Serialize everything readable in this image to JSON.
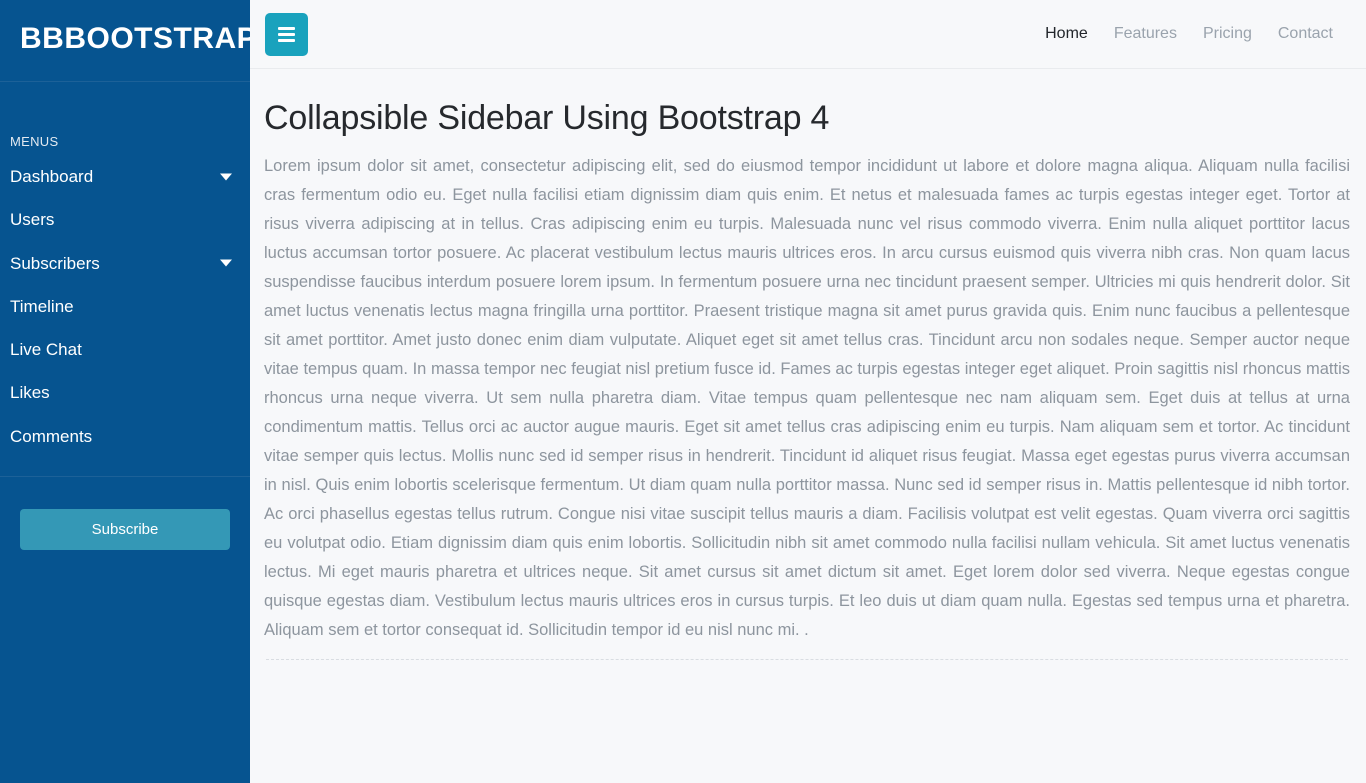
{
  "sidebar": {
    "brand": "BBBOOTSTRAP",
    "section_label": "MENUS",
    "items": [
      {
        "label": "Dashboard",
        "has_caret": true
      },
      {
        "label": "Users",
        "has_caret": false
      },
      {
        "label": "Subscribers",
        "has_caret": true
      },
      {
        "label": "Timeline",
        "has_caret": false
      },
      {
        "label": "Live Chat",
        "has_caret": false
      },
      {
        "label": "Likes",
        "has_caret": false
      },
      {
        "label": "Comments",
        "has_caret": false
      }
    ],
    "subscribe_label": "Subscribe",
    "bg_color": "#065490",
    "subscribe_color": "#3498b6"
  },
  "navbar": {
    "toggle_label": "",
    "toggle_color": "#19a2bd",
    "links": [
      {
        "label": "Home",
        "active": true
      },
      {
        "label": "Features",
        "active": false
      },
      {
        "label": "Pricing",
        "active": false
      },
      {
        "label": "Contact",
        "active": false
      }
    ]
  },
  "main": {
    "title": "Collapsible Sidebar Using Bootstrap 4",
    "paragraph": "Lorem ipsum dolor sit amet, consectetur adipiscing elit, sed do eiusmod tempor incididunt ut labore et dolore magna aliqua. Aliquam nulla facilisi cras fermentum odio eu. Eget nulla facilisi etiam dignissim diam quis enim. Et netus et malesuada fames ac turpis egestas integer eget. Tortor at risus viverra adipiscing at in tellus. Cras adipiscing enim eu turpis. Malesuada nunc vel risus commodo viverra. Enim nulla aliquet porttitor lacus luctus accumsan tortor posuere. Ac placerat vestibulum lectus mauris ultrices eros. In arcu cursus euismod quis viverra nibh cras. Non quam lacus suspendisse faucibus interdum posuere lorem ipsum. In fermentum posuere urna nec tincidunt praesent semper. Ultricies mi quis hendrerit dolor. Sit amet luctus venenatis lectus magna fringilla urna porttitor. Praesent tristique magna sit amet purus gravida quis. Enim nunc faucibus a pellentesque sit amet porttitor. Amet justo donec enim diam vulputate. Aliquet eget sit amet tellus cras. Tincidunt arcu non sodales neque. Semper auctor neque vitae tempus quam. In massa tempor nec feugiat nisl pretium fusce id. Fames ac turpis egestas integer eget aliquet. Proin sagittis nisl rhoncus mattis rhoncus urna neque viverra. Ut sem nulla pharetra diam. Vitae tempus quam pellentesque nec nam aliquam sem. Eget duis at tellus at urna condimentum mattis. Tellus orci ac auctor augue mauris. Eget sit amet tellus cras adipiscing enim eu turpis. Nam aliquam sem et tortor. Ac tincidunt vitae semper quis lectus. Mollis nunc sed id semper risus in hendrerit. Tincidunt id aliquet risus feugiat. Massa eget egestas purus viverra accumsan in nisl. Quis enim lobortis scelerisque fermentum. Ut diam quam nulla porttitor massa. Nunc sed id semper risus in. Mattis pellentesque id nibh tortor. Ac orci phasellus egestas tellus rutrum. Congue nisi vitae suscipit tellus mauris a diam. Facilisis volutpat est velit egestas. Quam viverra orci sagittis eu volutpat odio. Etiam dignissim diam quis enim lobortis. Sollicitudin nibh sit amet commodo nulla facilisi nullam vehicula. Sit amet luctus venenatis lectus. Mi eget mauris pharetra et ultrices neque. Sit amet cursus sit amet dictum sit amet. Eget lorem dolor sed viverra. Neque egestas congue quisque egestas diam. Vestibulum lectus mauris ultrices eros in cursus turpis. Et leo duis ut diam quam nulla. Egestas sed tempus urna et pharetra. Aliquam sem et tortor consequat id. Sollicitudin tempor id eu nisl nunc mi. ."
  }
}
